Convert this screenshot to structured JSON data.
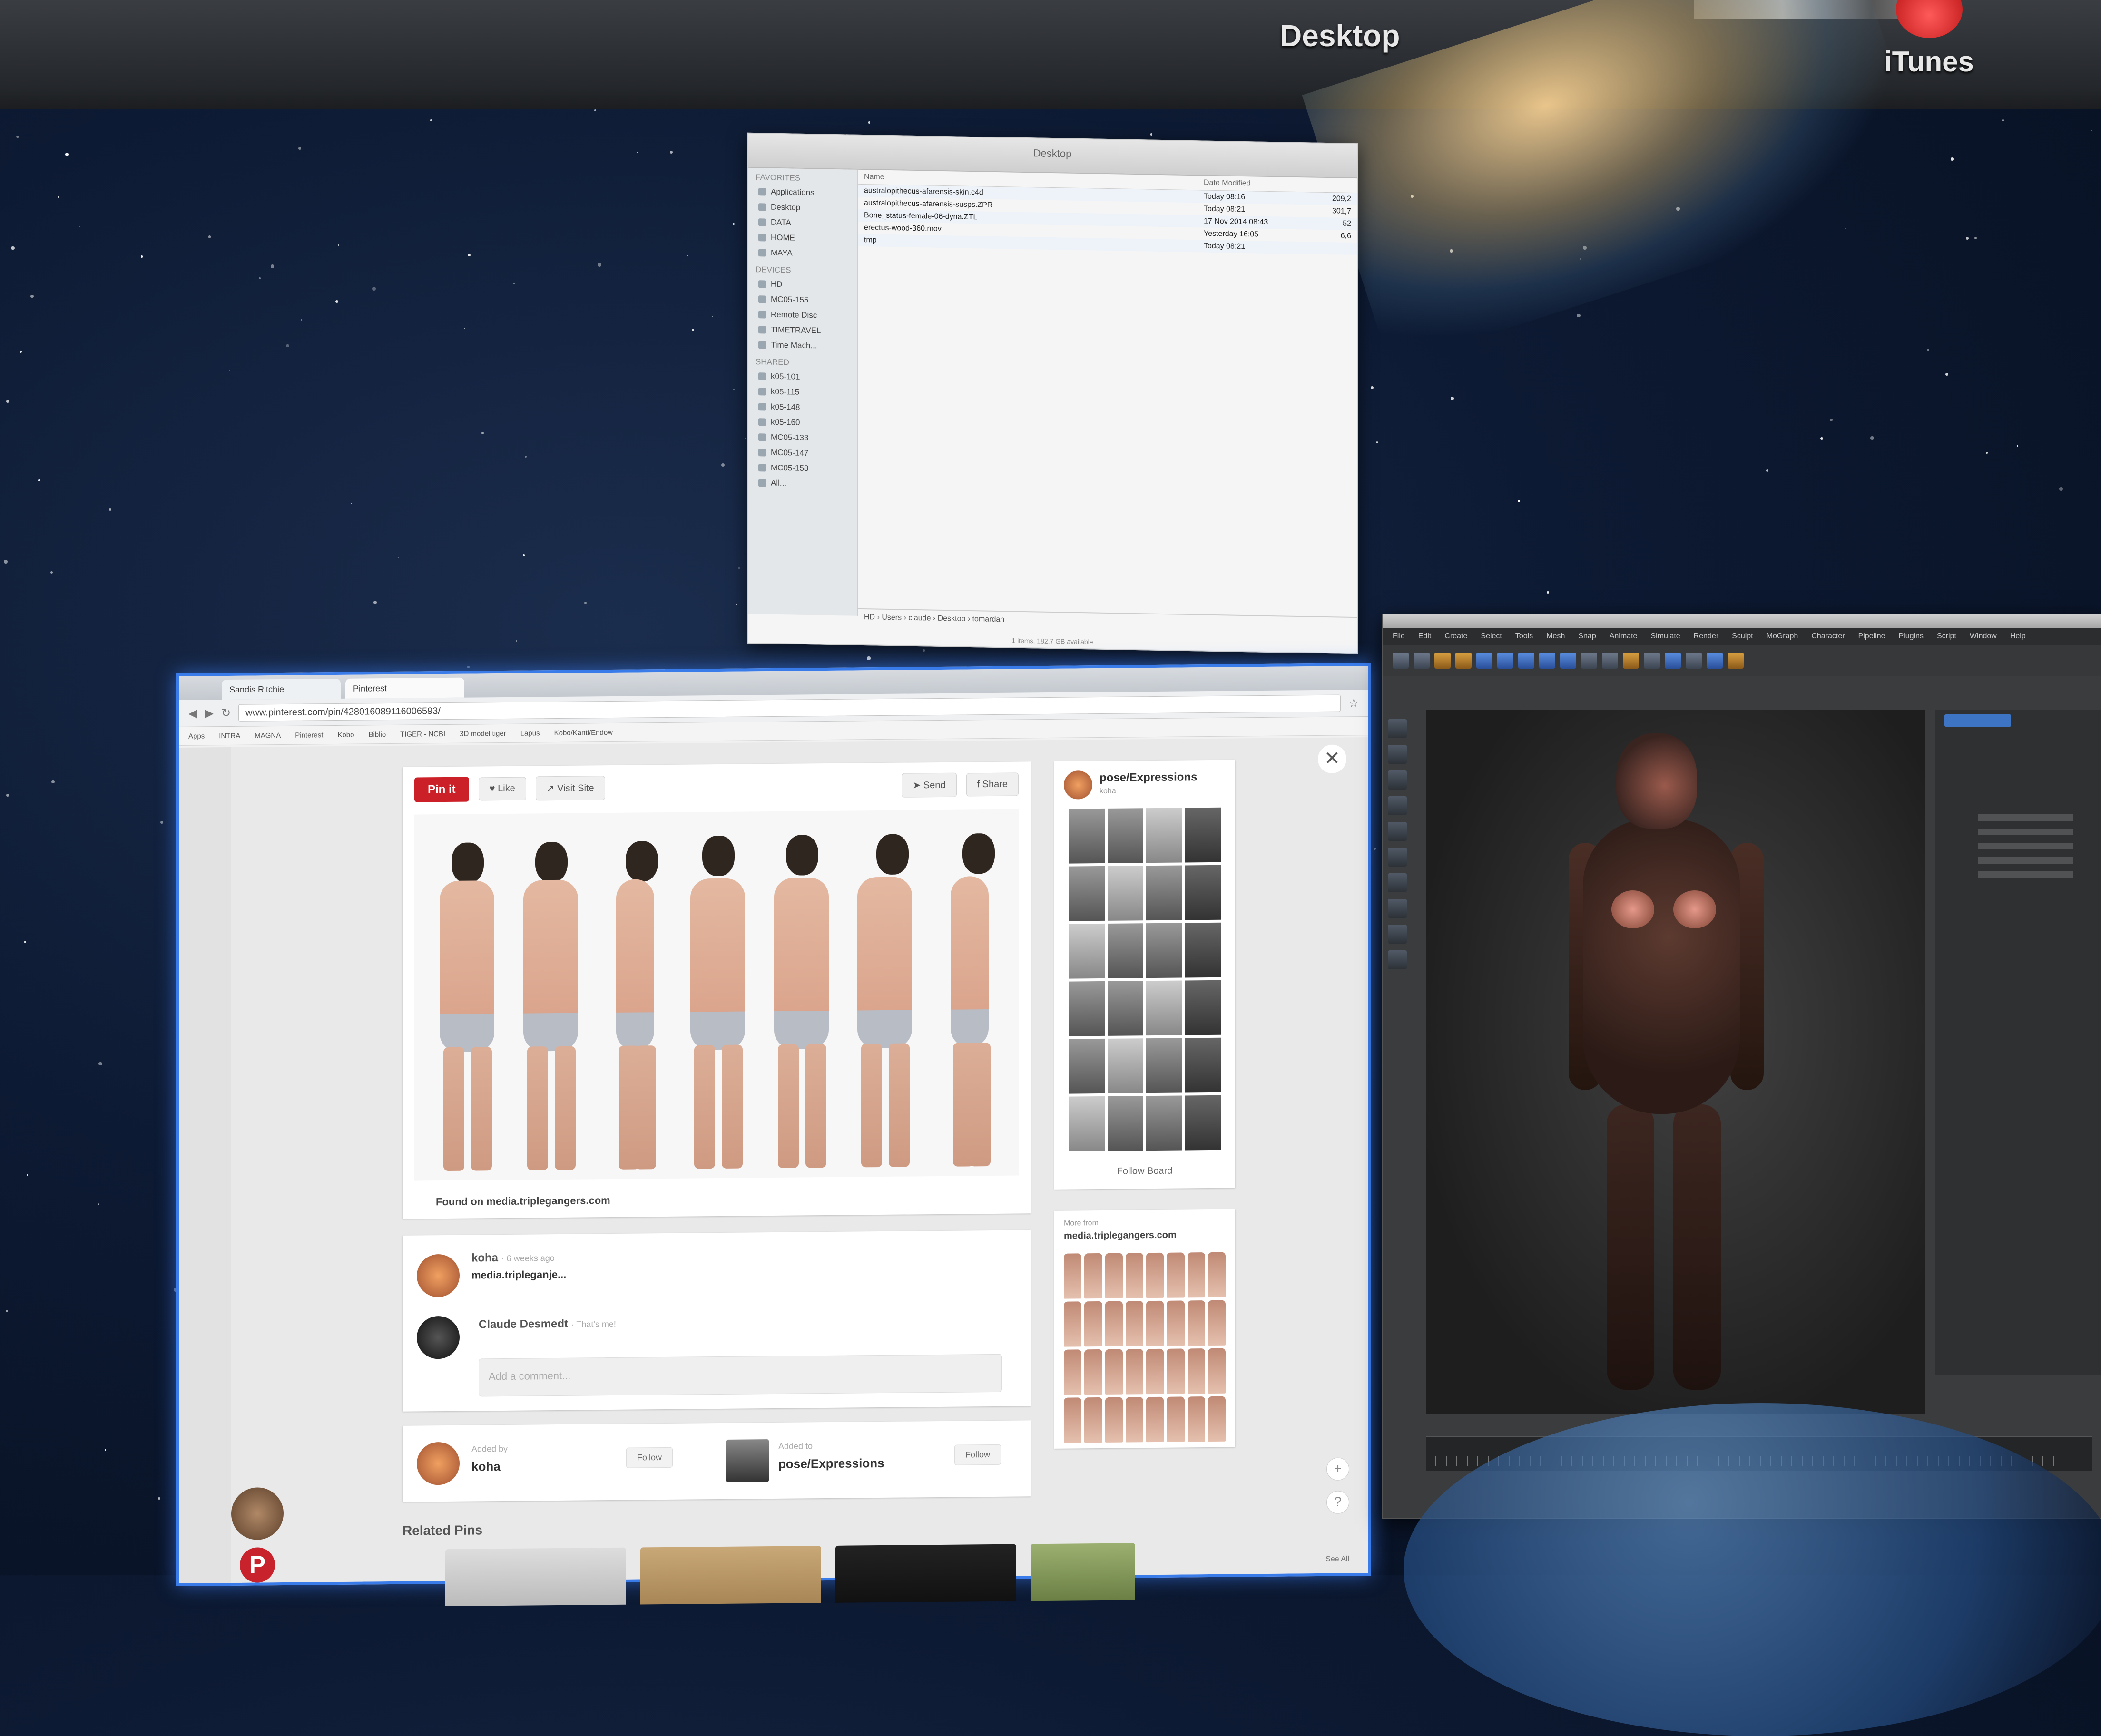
{
  "mission_control": {
    "spaces": [
      {
        "label": "Desktop"
      },
      {
        "label": "iTunes"
      }
    ]
  },
  "finder": {
    "title": "Desktop",
    "sidebar": [
      {
        "header": "Favorites",
        "items": [
          "Applications",
          "Desktop",
          "DATA",
          "HOME",
          "MAYA"
        ]
      },
      {
        "header": "Devices",
        "items": [
          "HD",
          "MC05-155",
          "Remote Disc",
          "TIMETRAVEL",
          "Time Mach..."
        ]
      },
      {
        "header": "Shared",
        "items": [
          "k05-101",
          "k05-115",
          "k05-148",
          "k05-160",
          "MC05-133",
          "MC05-147",
          "MC05-158",
          "All..."
        ]
      }
    ],
    "columns": {
      "name": "Name",
      "date": "Date Modified",
      "size": ""
    },
    "files": [
      {
        "name": "australopithecus-afarensis-skin.c4d",
        "date": "Today 08:16",
        "size": "209,2"
      },
      {
        "name": "australopithecus-afarensis-susps.ZPR",
        "date": "Today 08:21",
        "size": "301,7"
      },
      {
        "name": "Bone_status-female-06-dyna.ZTL",
        "date": "17 Nov 2014 08:43",
        "size": "52"
      },
      {
        "name": "erectus-wood-360.mov",
        "date": "Yesterday 16:05",
        "size": "6,6"
      },
      {
        "name": "tmp",
        "date": "Today 08:21",
        "size": ""
      }
    ],
    "path": "HD › Users › claude › Desktop › tomardan",
    "status": "1 items, 182,7 GB available"
  },
  "browser": {
    "tabs": [
      "Sandis Ritchie",
      "Pinterest"
    ],
    "url": "www.pinterest.com/pin/428016089116006593/",
    "bookmarks": [
      "Apps",
      "INTRA",
      "MAGNA",
      "Pinterest",
      "Kobo",
      "Biblio",
      "TIGER - NCBI",
      "3D model tiger",
      "Lapus",
      "Kobo/Kanti/Endow"
    ],
    "close_glyph": "✕",
    "pin": {
      "pin_it": "Pin it",
      "like": "Like",
      "visit_site": "Visit Site",
      "send": "Send",
      "share": "Share",
      "found_on": "Found on media.triplegangers.com"
    },
    "board": {
      "title": "pose/Expressions",
      "owner": "koha",
      "follow": "Follow Board"
    },
    "comments": {
      "pinner_name": "koha",
      "pinner_meta": "· 6 weeks ago",
      "pinner_link": "media.tripleganje...",
      "commenter_name": "Claude Desmedt",
      "commenter_meta": "· That's me!",
      "placeholder": "Add a comment..."
    },
    "added": {
      "added_by_label": "Added by",
      "added_by_name": "koha",
      "follow1": "Follow",
      "added_to_label": "Added to",
      "added_to_name": "pose/Expressions",
      "follow2": "Follow"
    },
    "more_from": {
      "label": "More from",
      "source": "media.triplegangers.com"
    },
    "related_title": "Related Pins",
    "see_all": "See All",
    "rail_logo": "P"
  },
  "app3d": {
    "menu": [
      "File",
      "Edit",
      "Create",
      "Select",
      "Tools",
      "Mesh",
      "Snap",
      "Animate",
      "Simulate",
      "Render",
      "Sculpt",
      "MoGraph",
      "Character",
      "Pipeline",
      "Plugins",
      "Script",
      "Window",
      "Help"
    ]
  }
}
